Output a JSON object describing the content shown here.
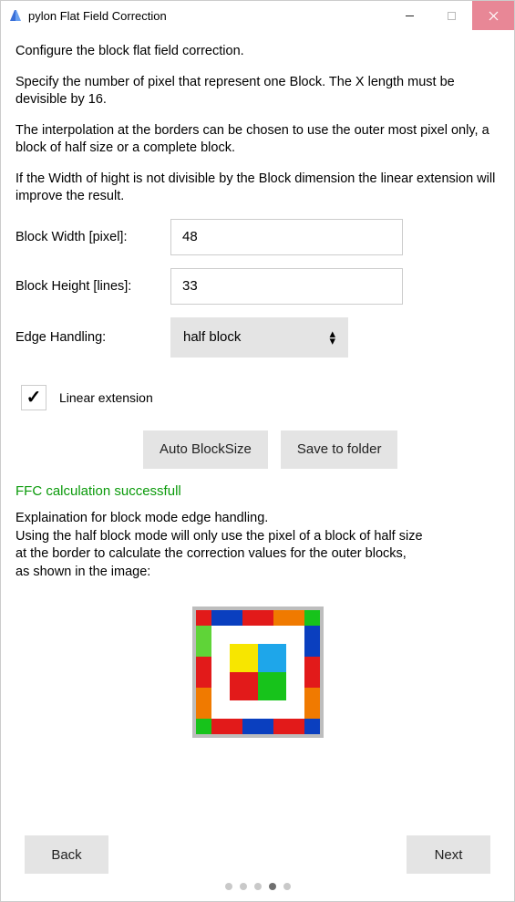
{
  "window": {
    "title": "pylon Flat Field Correction"
  },
  "intro": {
    "p1": "Configure the block flat field correction.",
    "p2": "Specify the number of pixel that represent one Block. The X length must be devisible by 16.",
    "p3": "The interpolation at the borders can be chosen to use the outer most pixel only, a block of half size or a complete block.",
    "p4": " If the Width of hight is not divisible by the Block dimension the linear extension will improve the result."
  },
  "form": {
    "block_width_label": "Block Width [pixel]:",
    "block_width_value": "48",
    "block_height_label": "Block Height [lines]:",
    "block_height_value": "33",
    "edge_handling_label": "Edge Handling:",
    "edge_handling_value": "half block",
    "linear_ext_label": "Linear extension",
    "linear_ext_checked": true
  },
  "buttons": {
    "auto_blocksize": "Auto BlockSize",
    "save_folder": "Save to folder",
    "back": "Back",
    "next": "Next"
  },
  "status": "FFC calculation successfull",
  "explain": {
    "title": "Explaination for block mode edge handling.",
    "line2": "Using the half block mode will only use the pixel of a block of half size",
    "line3": "at the border to calculate the correction values for the outer blocks,",
    "line4": "as shown in the image:"
  },
  "diagram": {
    "colors": {
      "red": "#e21a1a",
      "blue": "#0a3fbf",
      "orange": "#f07a00",
      "green": "#17c31b",
      "lgreen": "#5fd438",
      "yellow": "#f7e600",
      "lblue": "#1ea6ea",
      "white": "#ffffff"
    }
  },
  "pager": {
    "count": 5,
    "active_index": 3
  }
}
